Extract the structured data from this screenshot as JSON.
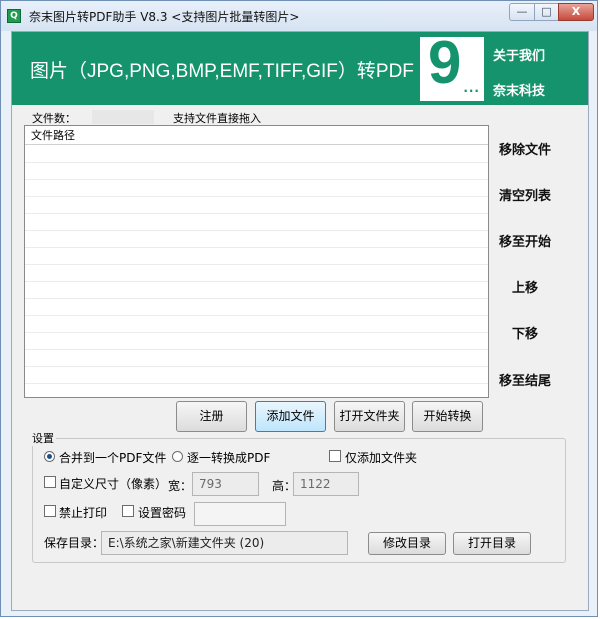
{
  "window": {
    "title": "奈末图片转PDF助手 V8.3  <支持图片批量转图片>",
    "controls": {
      "min": "—",
      "max": "□",
      "close": "X"
    }
  },
  "banner": {
    "title": "图片（JPG,PNG,BMP,EMF,TIFF,GIF）转PDF",
    "logo_digit": "9",
    "logo_dots": "...",
    "about_link": "关于我们",
    "company_link": "奈末科技",
    "background_color": "#14936d"
  },
  "file_info": {
    "count_label": "文件数：",
    "count_value": "",
    "drag_hint": "支持文件直接拖入"
  },
  "file_list": {
    "column_header": "文件路径",
    "rows": []
  },
  "side_actions": {
    "remove": "移除文件",
    "clear": "清空列表",
    "move_top": "移至开始",
    "move_up": "上移",
    "move_down": "下移",
    "move_bottom": "移至结尾"
  },
  "toolbar": {
    "register": "注册",
    "add_files": "添加文件",
    "open_folder": "打开文件夹",
    "start": "开始转换"
  },
  "settings": {
    "group_title": "设置",
    "merge_option": "合并到一个PDF文件",
    "merge_selected": true,
    "separate_option": "逐一转换成PDF",
    "folders_only": "仅添加文件夹",
    "custom_size": "自定义尺寸（像素）",
    "width_label": "宽：",
    "width_value": "793",
    "height_label": "高：",
    "height_value": "1122",
    "no_print": "禁止打印",
    "set_password": "设置密码",
    "password_value": "",
    "save_dir_label": "保存目录：",
    "save_dir_value": "E:\\系统之家\\新建文件夹 (20)",
    "change_dir": "修改目录",
    "open_dir": "打开目录"
  }
}
